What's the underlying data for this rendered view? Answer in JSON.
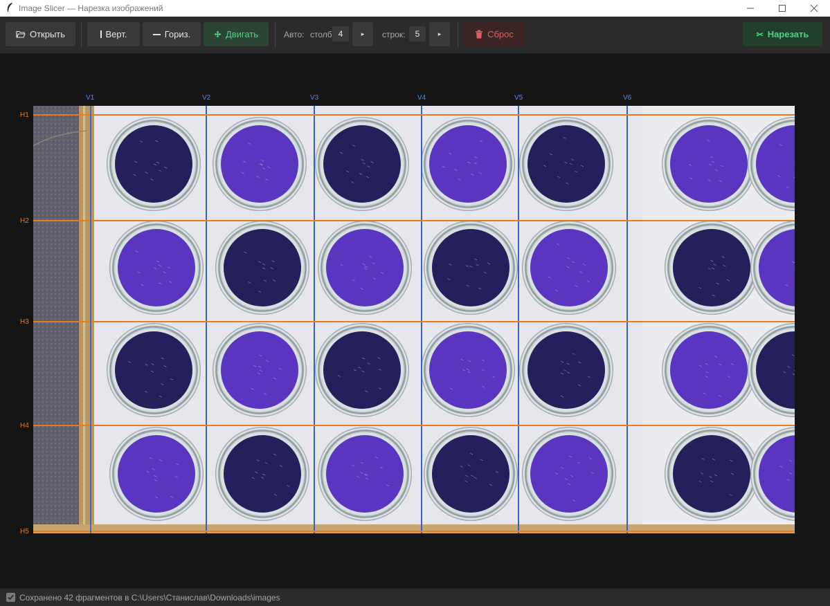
{
  "window": {
    "title": "Image Slicer — Нарезка изображений"
  },
  "toolbar": {
    "open_label": "Открыть",
    "vert_label": "Верт.",
    "horiz_label": "Гориз.",
    "move_label": "Двигать",
    "auto_label": "Авто:",
    "cols_label": "столб:",
    "cols_value": "4",
    "rows_label": "строк:",
    "rows_value": "5",
    "reset_label": "Сброс",
    "slice_label": "Нарезать"
  },
  "guides": {
    "vertical": [
      "V1",
      "V2",
      "V3",
      "V4",
      "V5",
      "V6"
    ],
    "horizontal": [
      "H1",
      "H2",
      "H3",
      "H4",
      "H5"
    ]
  },
  "status": {
    "text": "Сохранено 42 фрагментов в C:\\Users\\Станислав\\Downloads\\images"
  },
  "colors": {
    "vertical_guide": "#2f63c9",
    "horizontal_guide": "#ea7b1f",
    "move_button": "#48d684",
    "reset_button": "#e06060",
    "slice_button": "#48d684",
    "plate_violet": "#5a36c0",
    "plate_navy": "#25205c"
  },
  "photo": {
    "petri_dish_grid": [
      [
        "navy",
        "violet",
        "navy",
        "violet",
        "navy",
        "violet",
        "violet"
      ],
      [
        "violet",
        "navy",
        "violet",
        "navy",
        "violet",
        "navy",
        "violet"
      ],
      [
        "navy",
        "violet",
        "navy",
        "violet",
        "navy",
        "violet",
        "navy"
      ],
      [
        "violet",
        "navy",
        "violet",
        "navy",
        "violet",
        "navy",
        "violet"
      ]
    ]
  }
}
